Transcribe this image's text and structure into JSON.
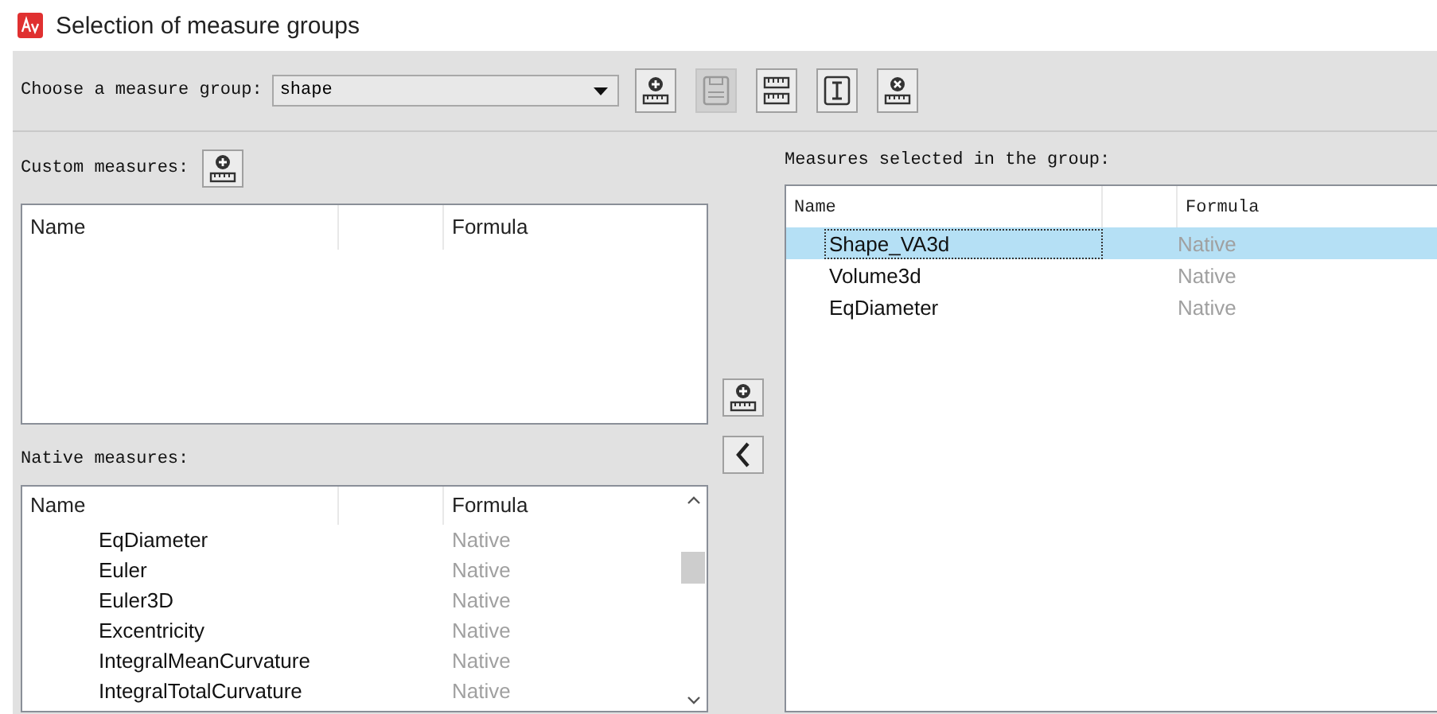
{
  "window": {
    "title": "Selection of measure groups"
  },
  "group_picker": {
    "label": "Choose a measure group:",
    "value": "shape"
  },
  "toolbar": [
    {
      "kind": "add",
      "disabled": false
    },
    {
      "kind": "save",
      "disabled": true
    },
    {
      "kind": "pair",
      "disabled": false
    },
    {
      "kind": "text",
      "disabled": false
    },
    {
      "kind": "remove",
      "disabled": false
    }
  ],
  "custom_measures": {
    "label": "Custom measures:",
    "columns": [
      "Name",
      "Formula"
    ]
  },
  "native_measures": {
    "label": "Native measures:",
    "columns": [
      "Name",
      "Formula"
    ],
    "rows": [
      {
        "name": "EqDiameter",
        "formula": "Native"
      },
      {
        "name": "Euler",
        "formula": "Native"
      },
      {
        "name": "Euler3D",
        "formula": "Native"
      },
      {
        "name": "Excentricity",
        "formula": "Native"
      },
      {
        "name": "IntegralMeanCurvature",
        "formula": "Native"
      },
      {
        "name": "IntegralTotalCurvature",
        "formula": "Native"
      }
    ]
  },
  "selected_measures": {
    "label": "Measures selected in the group:",
    "columns": [
      "Name",
      "Formula"
    ],
    "rows": [
      {
        "name": "Shape_VA3d",
        "formula": "Native",
        "selected": true
      },
      {
        "name": "Volume3d",
        "formula": "Native",
        "selected": false
      },
      {
        "name": "EqDiameter",
        "formula": "Native",
        "selected": false
      }
    ]
  },
  "move_buttons": [
    {
      "kind": "add"
    },
    {
      "kind": "back"
    }
  ]
}
